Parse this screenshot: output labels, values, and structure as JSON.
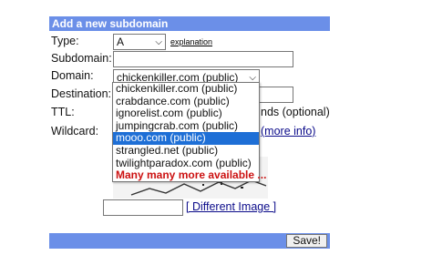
{
  "form": {
    "title": "Add a new subdomain",
    "type": {
      "label": "Type:",
      "value": "A",
      "explanation": "explanation"
    },
    "subdomain": {
      "label": "Subdomain:",
      "value": ""
    },
    "domain": {
      "label": "Domain:",
      "value": "chickenkiller.com (public)",
      "options": [
        "chickenkiller.com (public)",
        "crabdance.com (public)",
        "ignorelist.com (public)",
        "jumpingcrab.com (public)",
        "mooo.com (public)",
        "strangled.net (public)",
        "twilightparadox.com (public)",
        "Many many more available ..."
      ],
      "highlighted_index": 4
    },
    "destination": {
      "label": "Destination:",
      "value": ""
    },
    "ttl": {
      "label": "TTL:",
      "partial_text": "nds (optional)"
    },
    "wildcard": {
      "label": "Wildcard:",
      "more_info": "(more info)"
    },
    "captcha": {
      "input_value": "",
      "different_image": "[ Different Image ]"
    },
    "save_label": "Save!"
  },
  "colors": {
    "header": "#6b8fe8",
    "selected_option": "#1e6fd6",
    "more_option": "#cc1111"
  }
}
